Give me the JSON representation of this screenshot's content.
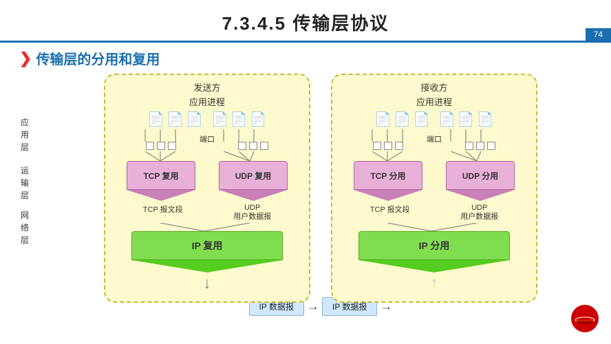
{
  "header": {
    "title": "7.3.4.5    传输层协议",
    "page_number": "74"
  },
  "section": {
    "heading": "传输层的分用和复用"
  },
  "side_labels": {
    "app_layer": "应\n用\n层",
    "transport_layer": "运\n输\n层",
    "network_layer": "网\n络\n层"
  },
  "sender": {
    "label": "发送方",
    "sub_label": "应用进程",
    "port_label": "端口",
    "tcp_label": "TCP 复用",
    "udp_label": "UDP 复用",
    "tcp_segment": "TCP 报文段",
    "udp_datagram_line1": "UDP",
    "udp_datagram_line2": "用户数据报",
    "ip_label": "IP 复用"
  },
  "receiver": {
    "label": "接收方",
    "sub_label": "应用进程",
    "port_label": "端口",
    "tcp_label": "TCP 分用",
    "udp_label": "UDP 分用",
    "tcp_segment": "TCP 报文段",
    "udp_datagram_line1": "UDP",
    "udp_datagram_line2": "用户数据报",
    "ip_label": "IP 分用"
  },
  "ip_data": {
    "label1": "IP 数据报",
    "label2": "IP 数据报"
  },
  "colors": {
    "blue": "#1a6faf",
    "red": "#e03030",
    "yellow_bg": "#fffacd",
    "purple": "#e8b0d8",
    "green": "#90ee60"
  }
}
